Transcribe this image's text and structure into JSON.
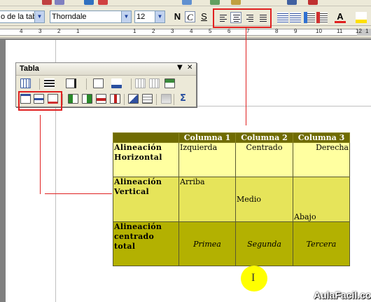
{
  "formatting": {
    "style_value": "o de la tabla",
    "font_value": "Thorndale",
    "size_value": "12",
    "bold": "N",
    "italic": "C",
    "underline": "S"
  },
  "ruler": {
    "numbers": [
      "4",
      "3",
      "2",
      "1",
      "1",
      "2",
      "3",
      "4",
      "5",
      "6",
      "7",
      "8",
      "9",
      "10",
      "11",
      "12",
      "1"
    ]
  },
  "tabla_toolbar": {
    "title": "Tabla",
    "menu_symbol": "▼",
    "close_symbol": "✕"
  },
  "table": {
    "headers": [
      "",
      "Columna 1",
      "Columna 2",
      "Columna 3"
    ],
    "rows": [
      {
        "label_1": "Alineación",
        "label_2": "Horizontal",
        "c1": "Izquierda",
        "c2": "Centrado",
        "c3": "Derecha"
      },
      {
        "label_1": "Alineación",
        "label_2": "Vertical",
        "c1": "Arriba",
        "c2": "Medio",
        "c3": "Abajo"
      },
      {
        "label_1": "Alineación",
        "label_2": "centrado total",
        "c1": "Primea",
        "c2": "Segunda",
        "c3": "Tercera"
      }
    ]
  },
  "cursor_symbol": "I",
  "brand": "AulaFacil.com",
  "colors": {
    "header_bg": "#6f6b02",
    "row1_bg": "#ffffa0",
    "row2_bg": "#e6e45a",
    "row3_bg": "#b3b101",
    "highlight_red": "#e02020",
    "cursor_yellow": "#ffff00"
  }
}
